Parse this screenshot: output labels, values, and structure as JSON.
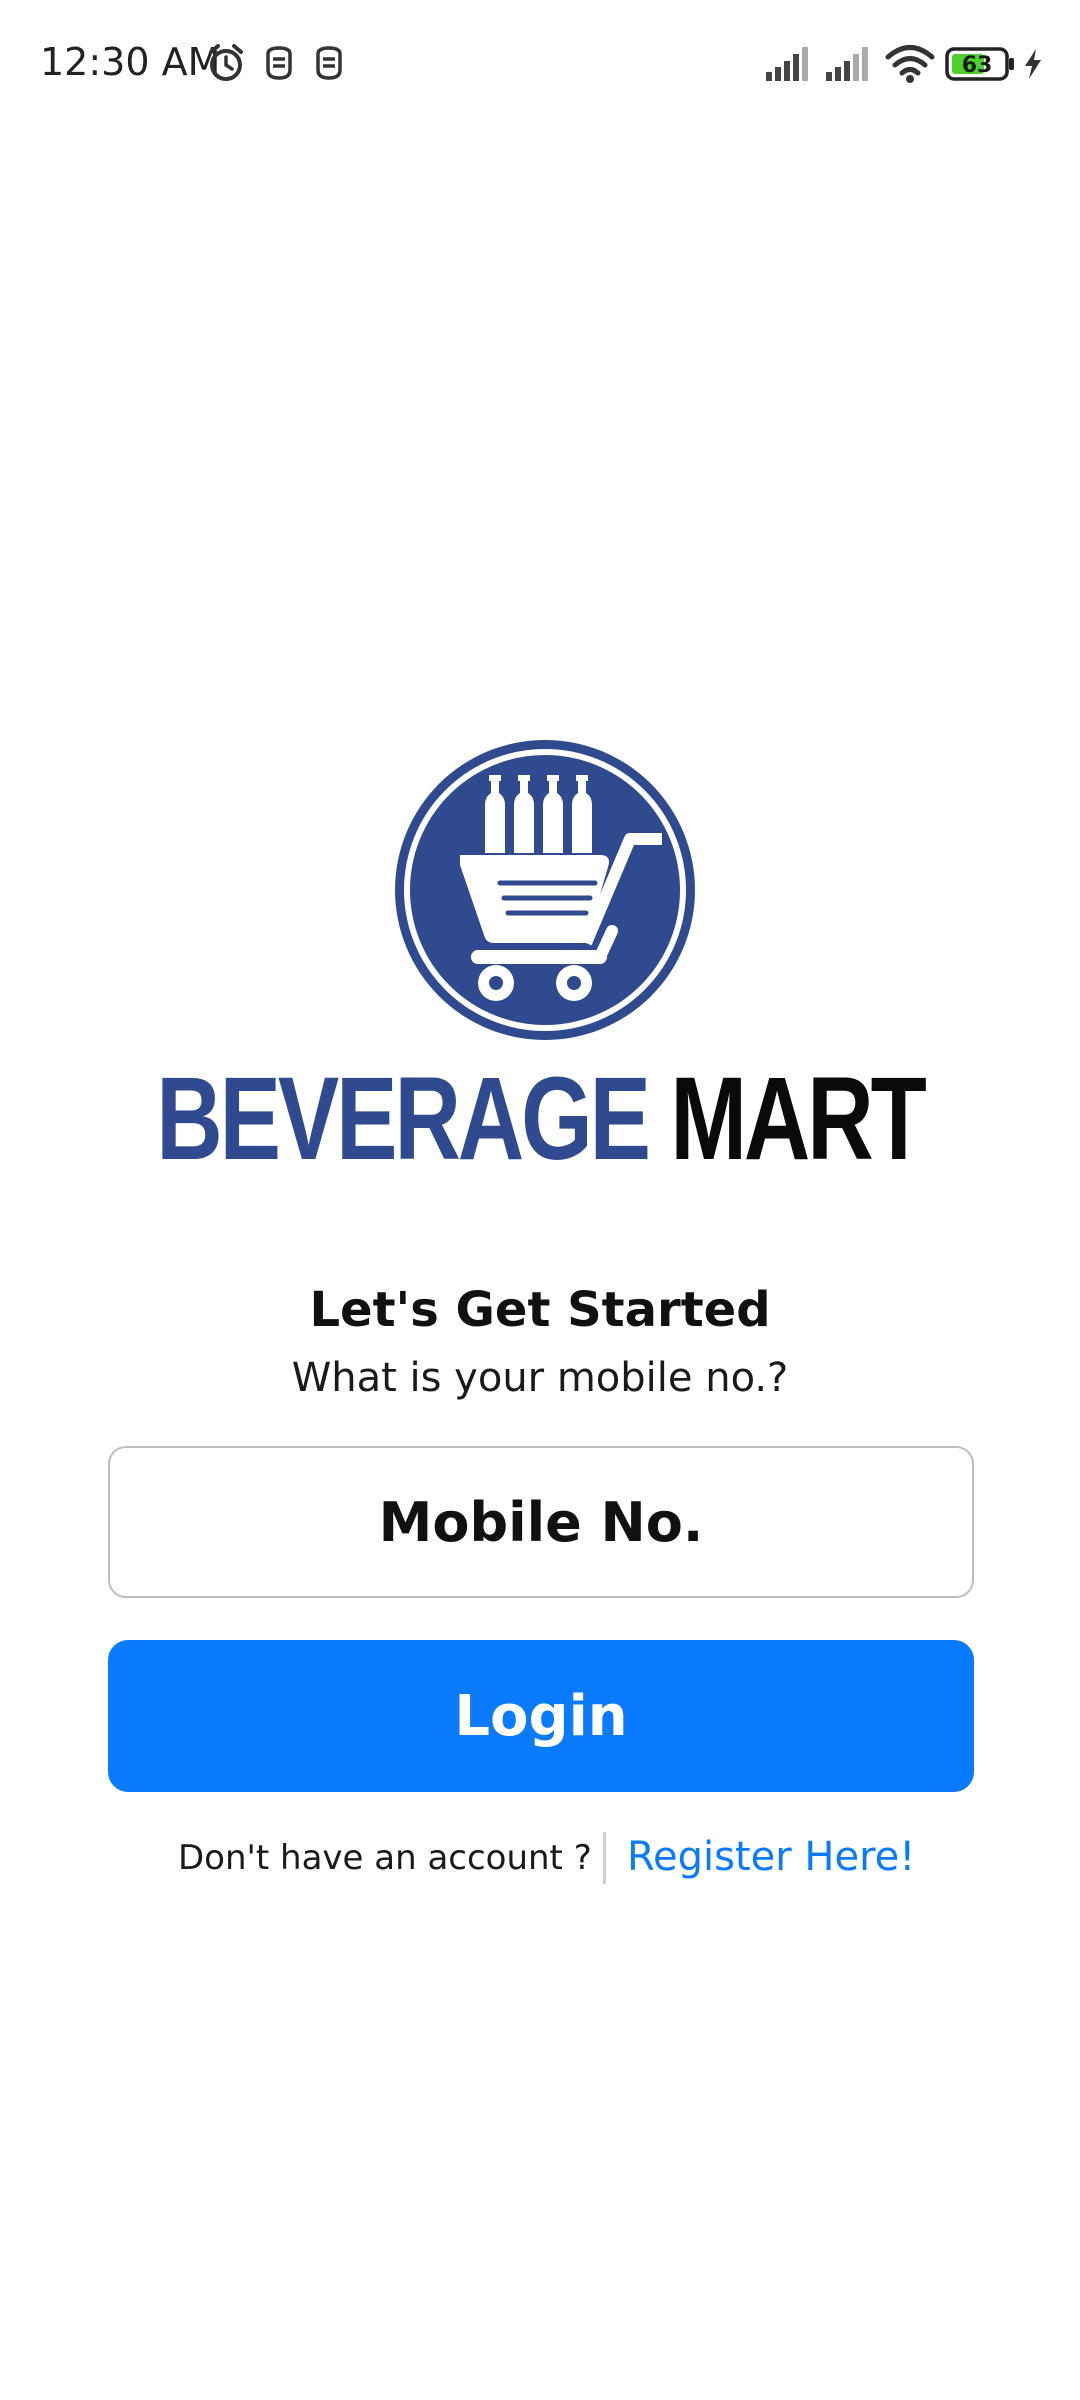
{
  "status_bar": {
    "time": "12:30 AM",
    "battery_level": "63",
    "icons": [
      "alarm-icon",
      "notification-icon",
      "notification-icon",
      "signal-icon",
      "signal-icon",
      "wifi-icon",
      "battery-icon",
      "charging-icon"
    ]
  },
  "brand": {
    "name_part1": "BEVERAGE",
    "name_part2": "MART",
    "color_primary": "#2f4a8f",
    "color_secondary": "#0a0a0a"
  },
  "login": {
    "heading": "Let's Get Started",
    "subheading": "What is your mobile no.?",
    "mobile_placeholder": "Mobile No.",
    "login_label": "Login",
    "no_account_text": "Don't have an account ?",
    "register_label": "Register Here!",
    "accent_color": "#0a7bff"
  }
}
